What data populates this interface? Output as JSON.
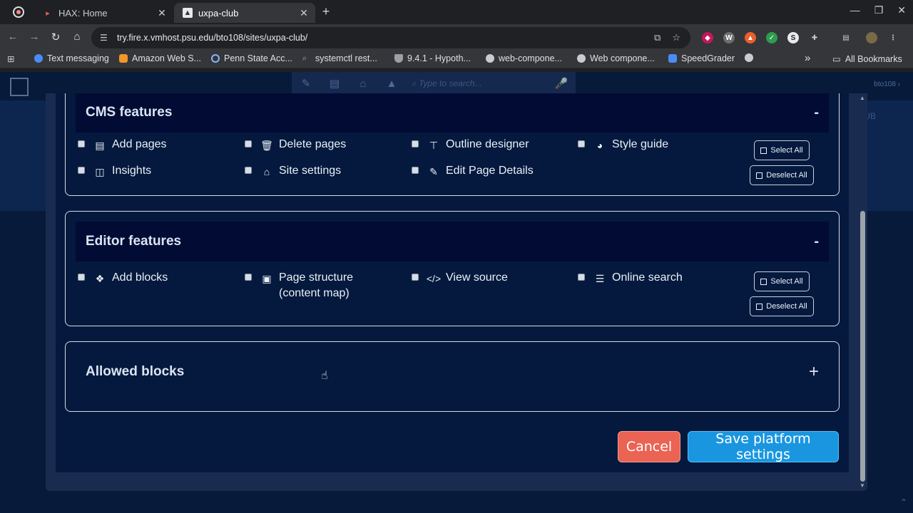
{
  "browser": {
    "tabs": [
      {
        "title": "HAX: Home",
        "active": false
      },
      {
        "title": "uxpa-club",
        "active": true
      }
    ],
    "url": "try.fire.x.vmhost.psu.edu/bto108/sites/uxpa-club/",
    "bookmarks": [
      {
        "label": "Text messaging",
        "color": "#4a8cf7"
      },
      {
        "label": "Amazon Web S...",
        "color": "#f3962b"
      },
      {
        "label": "Penn State Acc...",
        "color": "#8ab4f8"
      },
      {
        "label": "systemctl rest...",
        "color": "#8ab4f8"
      },
      {
        "label": "9.4.1 - Hypoth...",
        "color": "#9aa0a6"
      },
      {
        "label": "web-compone...",
        "color": "#c8cbd0"
      },
      {
        "label": "Web compone...",
        "color": "#c8cbd0"
      },
      {
        "label": "SpeedGrader",
        "color": "#4a8cf7"
      }
    ],
    "all_bookmarks": "All Bookmarks",
    "more_bookmarks": "»"
  },
  "hax": {
    "search_placeholder": "Type to search...",
    "username": "bto108",
    "club_suffix": "UB"
  },
  "cms_section": {
    "title": "CMS features",
    "toggle": "-",
    "features": [
      {
        "label": "Add pages",
        "icon": "add-page-icon"
      },
      {
        "label": "Delete pages",
        "icon": "trash-icon"
      },
      {
        "label": "Outline designer",
        "icon": "sitemap-icon"
      },
      {
        "label": "Style guide",
        "icon": "palette-icon"
      },
      {
        "label": "Insights",
        "icon": "insights-icon"
      },
      {
        "label": "Site settings",
        "icon": "home-settings-icon"
      },
      {
        "label": "Edit Page Details",
        "icon": "edit-document-icon"
      }
    ],
    "select_all": "Select All",
    "deselect_all": "Deselect All"
  },
  "editor_section": {
    "title": "Editor features",
    "toggle": "-",
    "features": [
      {
        "label": "Add blocks",
        "icon": "add-blocks-icon"
      },
      {
        "label": "Page structure (content map)",
        "icon": "content-map-icon"
      },
      {
        "label": "View source",
        "icon": "code-icon"
      },
      {
        "label": "Online search",
        "icon": "search-list-icon"
      }
    ],
    "select_all": "Select All",
    "deselect_all": "Deselect All"
  },
  "blocks_section": {
    "title": "Allowed blocks",
    "toggle": "+"
  },
  "footer": {
    "cancel": "Cancel",
    "save": "Save platform settings"
  },
  "colors": {
    "cancel_bg": "#ea6353",
    "save_bg": "#1a96e0",
    "modal_bg": "#04193d",
    "section_header_bg": "#020b34"
  }
}
